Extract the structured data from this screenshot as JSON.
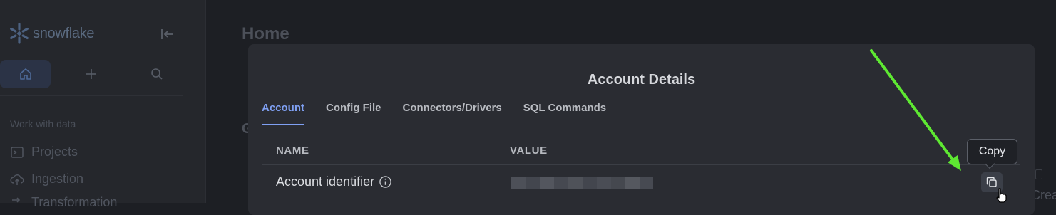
{
  "sidebar": {
    "logo_text": "snowflake",
    "section_label": "Work with data",
    "items": [
      {
        "label": "Projects",
        "icon": "terminal-icon"
      },
      {
        "label": "Ingestion",
        "icon": "cloud-upload-icon"
      },
      {
        "label": "Transformation",
        "icon": "transform-icon"
      }
    ]
  },
  "background": {
    "page_title": "Home",
    "partial_heading": "G",
    "partial_button": "Crea"
  },
  "modal": {
    "title": "Account Details",
    "tabs": [
      {
        "label": "Account",
        "active": true
      },
      {
        "label": "Config File",
        "active": false
      },
      {
        "label": "Connectors/Drivers",
        "active": false
      },
      {
        "label": "SQL Commands",
        "active": false
      }
    ],
    "table": {
      "columns": [
        "NAME",
        "VALUE"
      ],
      "rows": [
        {
          "name": "Account identifier",
          "value_redacted": true
        }
      ]
    }
  },
  "tooltip": {
    "text": "Copy"
  },
  "colors": {
    "accent": "#7fa0f3",
    "annotation_arrow": "#5ee832",
    "modal_bg": "#2a2c32"
  }
}
